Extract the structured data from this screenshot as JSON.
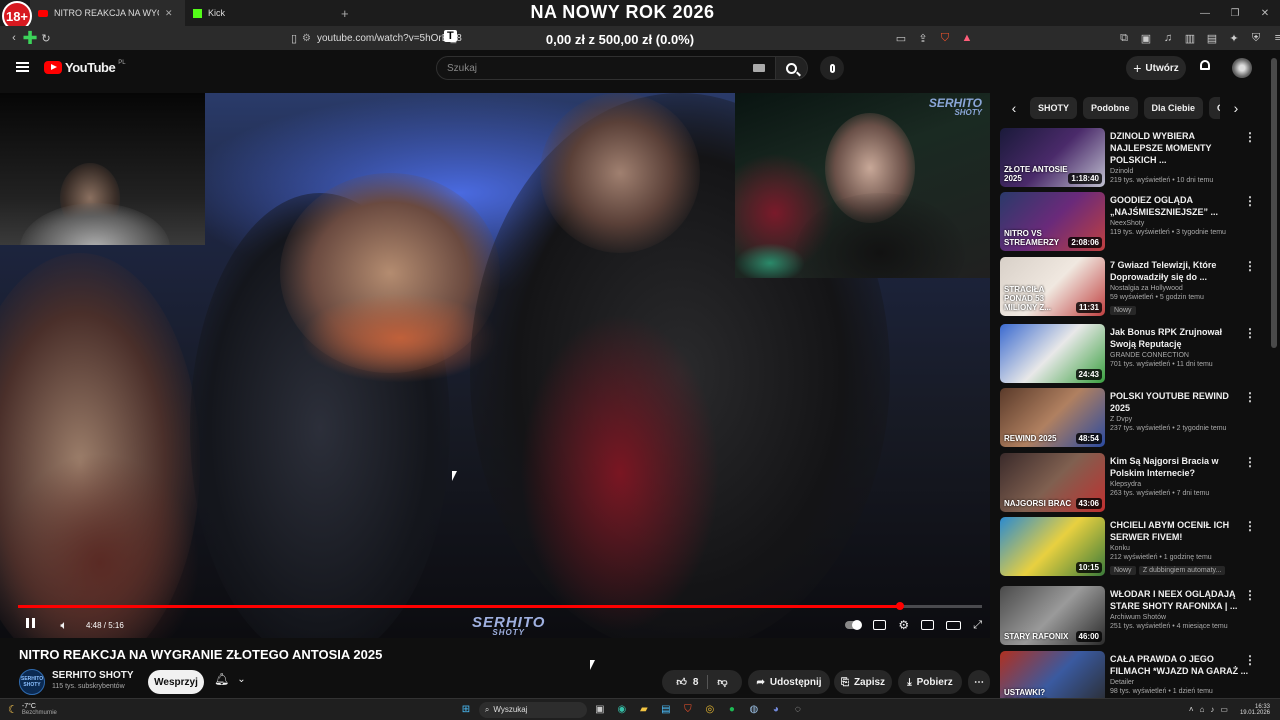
{
  "browser": {
    "tabs": [
      {
        "label": "NITRO REAKCJA NA WYGRAN",
        "active": true
      },
      {
        "label": "Kick",
        "active": false
      }
    ],
    "new_tab": "+",
    "url": "youtube.com/watch?v=5hOrBl_8"
  },
  "overlay": {
    "age_badge": "18+",
    "title": "NA NOWY ROK 2026",
    "donation": "0,00 zł z 500,00 zł (0.0%)",
    "badge_letter": "T"
  },
  "youtube": {
    "logo_text": "YouTube",
    "logo_region": "PL",
    "search_placeholder": "Szukaj",
    "create_label": "Utwórz"
  },
  "player": {
    "time": "4:48 / 5:16",
    "progress_fraction": 0.915,
    "watermark": "SERHITO",
    "watermark_sub": "SHOTY",
    "cam_watermark": "SERHITO",
    "cam_watermark_sub": "SHOTY"
  },
  "video": {
    "title": "NITRO REAKCJA NA WYGRANIE ZŁOTEGO ANTOSIA 2025",
    "channel": "SERHITO SHOTY",
    "avatar_text": "SERHITO SHOTY",
    "subscribers": "115 tys. subskrybentów",
    "support_label": "Wesprzyj",
    "likes": "8",
    "share_label": "Udostępnij",
    "save_label": "Zapisz",
    "download_label": "Pobierz"
  },
  "sidebar": {
    "chips": [
      "SHOTY",
      "Podobne",
      "Dla Ciebie",
      "Ostat"
    ],
    "videos": [
      {
        "title": "DZINOLD WYBIERA NAJLEPSZE MOMENTY POLSKICH ...",
        "channel": "Dzinold",
        "meta": "219 tys. wyświetleń • 10 dni temu",
        "duration": "1:18:40",
        "badge": "",
        "thumb_text": "ZŁOTE ANTOSIE 2025"
      },
      {
        "title": "GOODIEZ OGLĄDA „NAJŚMIESZNIEJSZE” ...",
        "channel": "NeexShoty",
        "meta": "119 tys. wyświetleń • 3 tygodnie temu",
        "duration": "2:08:06",
        "badge": "",
        "thumb_text": "NITRO VS STREAMERZY"
      },
      {
        "title": "7 Gwiazd Telewizji, Które Doprowadziły się do ...",
        "channel": "Nostalgia za Hollywood",
        "meta": "59 wyświetleń • 5 godzin temu",
        "duration": "11:31",
        "badge": "Nowy",
        "thumb_text": "STRACIŁA PONAD 53 MILIONY Z..."
      },
      {
        "title": "Jak Bonus RPK Zrujnował Swoją Reputację",
        "channel": "GRANDE CONNECTION",
        "meta": "701 tys. wyświetleń • 11 dni temu",
        "duration": "24:43",
        "badge": "",
        "thumb_text": ""
      },
      {
        "title": "POLSKI YOUTUBE REWIND 2025",
        "channel": "Z Dvpy",
        "meta": "237 tys. wyświetleń • 2 tygodnie temu",
        "duration": "48:54",
        "badge": "",
        "thumb_text": "REWIND 2025"
      },
      {
        "title": "Kim Są Najgorsi Bracia w Polskim Internecie?",
        "channel": "Klepsydra",
        "meta": "263 tys. wyświetleń • 7 dni temu",
        "duration": "43:06",
        "badge": "",
        "thumb_text": "NAJGORSI BRAC"
      },
      {
        "title": "CHCIELI ABYM OCENIŁ ICH SERWER FIVEM!",
        "channel": "Konku",
        "meta": "212 wyświetleń • 1 godzinę temu",
        "duration": "10:15",
        "badge": "Nowy",
        "badge2": "Z dubbingiem automaty...",
        "thumb_text": ""
      },
      {
        "title": "WŁODAR I NEEX OGLĄDAJĄ STARE SHOTY RAFONIXA | ...",
        "channel": "Archiwum Shotów",
        "meta": "251 tys. wyświetleń • 4 miesiące temu",
        "duration": "46:00",
        "badge": "",
        "thumb_text": "STARY RAFONIX"
      },
      {
        "title": "CAŁA PRAWDA O JEGO FILMACH *WJAZD NA GARAŻ ...",
        "channel": "Detailer",
        "meta": "98 tys. wyświetleń • 1 dzień temu",
        "duration": "",
        "badge": "",
        "thumb_text": "USTAWKI? SPONTAN?"
      }
    ]
  },
  "taskbar": {
    "weather_temp": "-7°C",
    "weather_desc": "Bezchmurnie",
    "search_label": "Wyszukaj",
    "time": "16:33",
    "date": "19.01.2026"
  }
}
